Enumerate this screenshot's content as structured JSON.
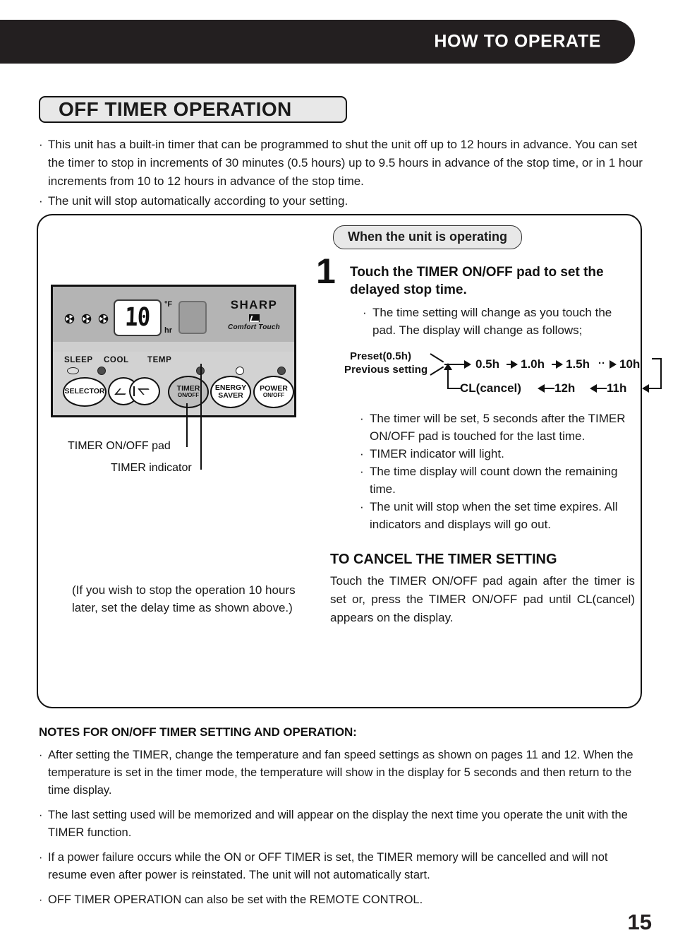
{
  "header": {
    "title": "HOW TO OPERATE"
  },
  "section": {
    "title": "OFF TIMER OPERATION"
  },
  "intro": {
    "bullet_char": "·",
    "items": [
      "This unit has a built-in timer that can be programmed to shut the unit off up to 12 hours in advance. You can set the timer to stop in increments of 30 minutes (0.5 hours) up to 9.5 hours in advance of the stop time, or in 1 hour increments from 10 to 12 hours in advance of the stop time.",
      "The unit will stop automatically according to your setting."
    ]
  },
  "panel": {
    "display_value": "10",
    "unit_f": "°F",
    "unit_hr": "hr",
    "brand": "SHARP",
    "brand_sub": "Comfort Touch",
    "indicator_labels": [
      "SLEEP",
      "COOL",
      "TEMP"
    ],
    "pads": [
      {
        "line1": "SELECTOR",
        "line2": ""
      },
      {
        "line1": "TIMER",
        "line2": "ON/OFF"
      },
      {
        "line1": "ENERGY",
        "line2": "SAVER"
      },
      {
        "line1": "POWER",
        "line2": "ON/OFF"
      }
    ],
    "callouts": {
      "pad": "TIMER ON/OFF pad",
      "indicator": "TIMER indicator"
    },
    "paren_note": "(If you wish to stop the operation 10 hours later, set the delay time as shown above.)"
  },
  "operating": {
    "pill_label": "When the unit is operating",
    "step_number": "1",
    "step_heading": "Touch the TIMER ON/OFF pad to set the delayed stop time.",
    "step_bullets": [
      "The time setting will change as you touch the pad. The display will change as follows;"
    ],
    "after_bullets": [
      "The timer will be set, 5 seconds after the TIMER ON/OFF pad is touched for the last time.",
      "TIMER indicator will light.",
      "The time display will count down the remaining time.",
      "The unit will stop when the set time expires. All indicators and displays will go out."
    ]
  },
  "flow": {
    "entry_line1": "Preset(0.5h)",
    "entry_line2": "Previous setting",
    "top_nodes": [
      "0.5h",
      "1.0h",
      "1.5h",
      "10h"
    ],
    "top_ellipsis": "··",
    "bottom_nodes": [
      "CL(cancel)",
      "12h",
      "11h"
    ]
  },
  "cancel": {
    "heading": "TO CANCEL THE TIMER SETTING",
    "body": "Touch the TIMER ON/OFF pad again after the timer is set or, press the TIMER ON/OFF pad until CL(cancel) appears on the display."
  },
  "notes": {
    "heading": "NOTES FOR ON/OFF TIMER SETTING AND OPERATION:",
    "bullet_char": "·",
    "items": [
      "After setting the TIMER, change the temperature and fan speed settings as shown on pages 11 and 12.  When the temperature is set in the timer mode, the temperature will show in the display for 5 seconds and then return to the time display.",
      "The last setting used will be memorized and will appear on the display the next time you operate the unit with the TIMER function.",
      "If a power failure occurs while the ON or OFF TIMER is set, the TIMER memory will be cancelled and will not resume even after power is reinstated.  The unit will not automatically start.",
      "OFF TIMER OPERATION can also be set with the REMOTE CONTROL."
    ]
  },
  "footer": {
    "page_number": "15"
  },
  "colors": {
    "header_band": "#231f20",
    "plaque_fill": "#e8e8e8",
    "panel_fill": "#b9b9b9",
    "ink": "#1a1a1a"
  }
}
